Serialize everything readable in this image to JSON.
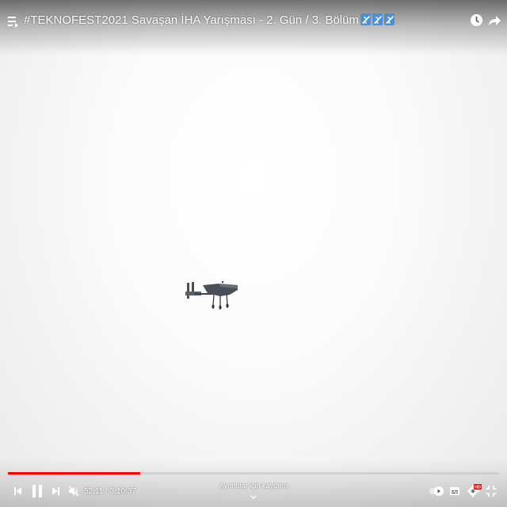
{
  "video": {
    "title": "#TEKNOFEST2021 Savaşan İHA Yarışması - 2. Gün / 3. Bölüm",
    "title_emojis": [
      "airplane-icon",
      "airplane-icon",
      "airplane-icon"
    ]
  },
  "header": {
    "queue_icon": "queue-icon",
    "watch_later_icon": "clock-icon",
    "share_icon": "share-arrow-icon"
  },
  "progress": {
    "played_fraction": 0.27,
    "played_color": "#ff0000",
    "track_color": "#c8c8c8"
  },
  "controls": {
    "time": "52:11 / 3:10:37",
    "details_hint": "Ayrıntılar için kaydırın",
    "icons": [
      "previous-icon",
      "pause-icon",
      "next-icon",
      "muted-speaker-icon",
      "autoplay-toggle-icon",
      "captions-icon",
      "settings-hd-icon",
      "exit-fullscreen-icon"
    ],
    "hd_badge": "HD",
    "hd_badge_color": "#ff0000"
  }
}
